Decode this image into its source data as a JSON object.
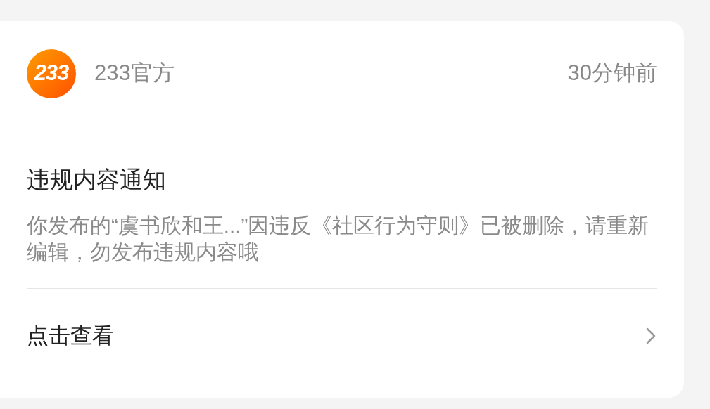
{
  "sender": {
    "logo_text": "233",
    "name": "233官方",
    "time": "30分钟前"
  },
  "notice": {
    "title": "违规内容通知",
    "body": "你发布的“虞书欣和王...”因违反《社区行为守则》已被删除，请重新编辑，勿发布违规内容哦"
  },
  "action": {
    "label": "点击查看"
  }
}
